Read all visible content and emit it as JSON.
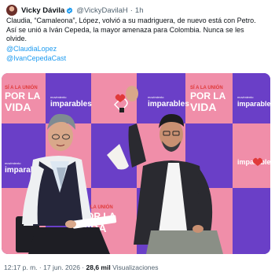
{
  "post": {
    "author_name": "Vicky Dávila",
    "author_handle": "@VickyDavilaH",
    "separator": "·",
    "relative_time": "1h",
    "text_lines": [
      "Claudia, “Camaleona”, López, volvió a su madriguera, de nuevo está con Petro.",
      "Así se unió a Iván Cepeda, la mayor amenaza para Colombia. Nunca se les",
      "olvide."
    ],
    "mentions": [
      "@ClaudiaLopez",
      "@IvanCepedaCast"
    ],
    "footer": {
      "time": "12:17 p. m.",
      "date": "17 jun. 2026",
      "separator": "·",
      "views_count": "28,6 mil",
      "views_label": "Visualizaciones"
    }
  },
  "banner": {
    "slogan": [
      "SÍ A LA UNIÓN",
      "POR LA",
      "VIDA"
    ],
    "brand_small": "movimiento",
    "brand": "imparables",
    "hashtag": "#"
  },
  "colors": {
    "purple": "#6a3fc7",
    "pink": "#f08ea9",
    "red": "#e03a3a",
    "link": "#1d9bf0",
    "muted": "#536471",
    "verified": "#1d9bf0"
  }
}
